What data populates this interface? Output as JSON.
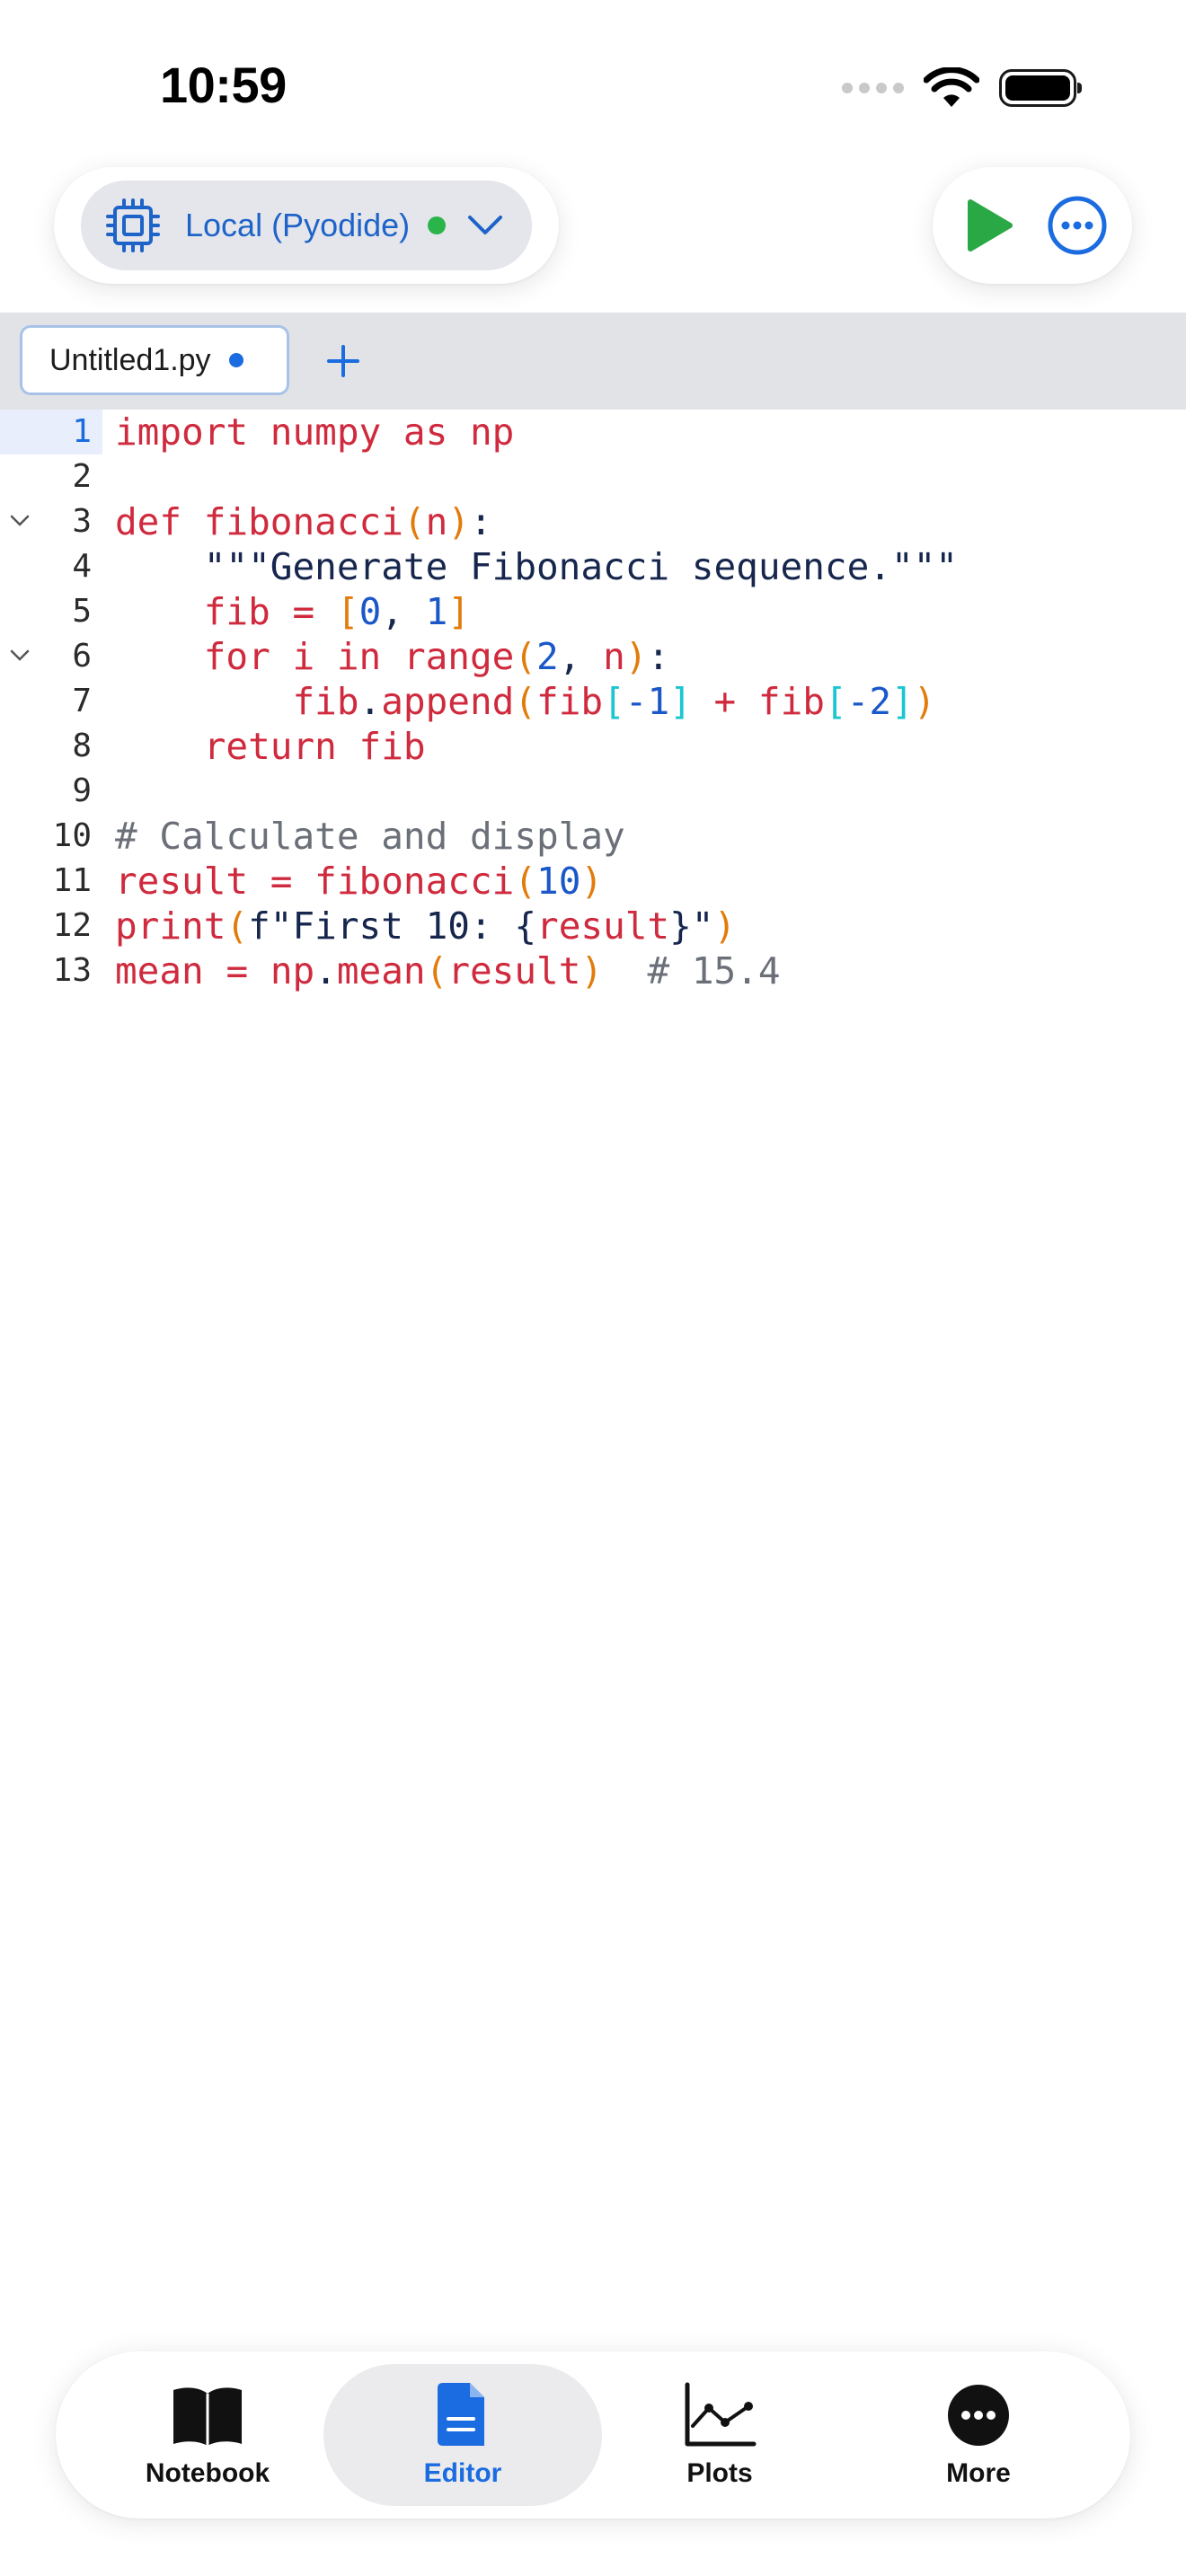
{
  "status_bar": {
    "time": "10:59"
  },
  "toolbar": {
    "runtime_label": "Local (Pyodide)",
    "runtime_status_color": "#2bb44a",
    "run_icon": "play-icon",
    "more_icon": "ellipsis-circle-icon"
  },
  "tabs": {
    "files": [
      {
        "name": "Untitled1.py",
        "unsaved": true
      }
    ],
    "add_icon": "plus-icon"
  },
  "editor": {
    "active_line": 1,
    "line_numbers": [
      "1",
      "2",
      "3",
      "4",
      "5",
      "6",
      "7",
      "8",
      "9",
      "10",
      "11",
      "12",
      "13"
    ],
    "lines": [
      "import numpy as np",
      "",
      "def fibonacci(n):",
      "    \"\"\"Generate Fibonacci sequence.\"\"\"",
      "    fib = [0, 1]",
      "    for i in range(2, n):",
      "        fib.append(fib[-1] + fib[-2])",
      "    return fib",
      "",
      "# Calculate and display",
      "result = fibonacci(10)",
      "print(f\"First 10: {result}\")",
      "mean = np.mean(result)  # 15.4"
    ],
    "foldable_lines": [
      3,
      6
    ]
  },
  "bottom_nav": {
    "items": [
      {
        "label": "Notebook",
        "icon": "book-icon"
      },
      {
        "label": "Editor",
        "icon": "document-icon"
      },
      {
        "label": "Plots",
        "icon": "line-chart-icon"
      },
      {
        "label": "More",
        "icon": "ellipsis-circle-icon"
      }
    ],
    "selected": "Editor"
  },
  "colors": {
    "accent": "#1a6ce0",
    "keyword": "#cf2a3d",
    "number": "#1a57c8",
    "bracket": "#e37b0b",
    "bracket_nested": "#19c6d1",
    "comment": "#6b6f78",
    "run_green": "#2aa845"
  }
}
